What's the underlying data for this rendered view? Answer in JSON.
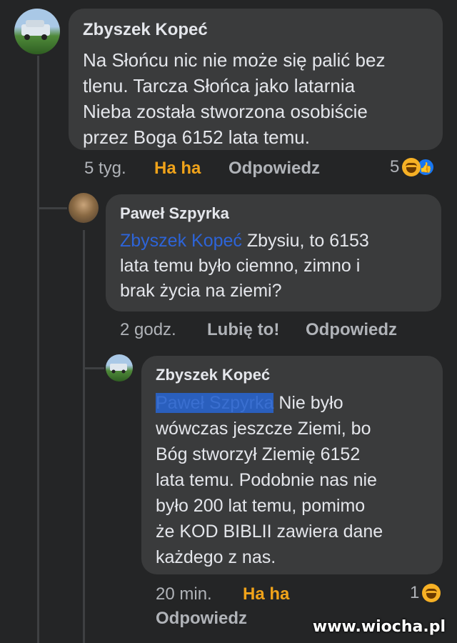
{
  "comments": [
    {
      "author": "Zbyszek Kopeć",
      "text_lines": [
        "Na Słońcu nic nie może się palić bez",
        "tlenu. Tarcza Słońca jako latarnia",
        "Nieba została stworzona osobiście",
        "przez Boga 6152 lata temu."
      ],
      "time": "5 tyg.",
      "reaction_label": "Ha ha",
      "reply_label": "Odpowiedz",
      "reaction_count": "5"
    },
    {
      "author": "Paweł Szpyrka",
      "mention": "Zbyszek Kopeć",
      "text_first": "Zbysiu, to 6153",
      "text_lines": [
        "lata temu było ciemno, zimno i",
        "brak życia na ziemi?"
      ],
      "time": "2 godz.",
      "like_label": "Lubię to!",
      "reply_label": "Odpowiedz"
    },
    {
      "author": "Zbyszek Kopeć",
      "mention": "Paweł Szpyrka",
      "text_first": "Nie było",
      "text_lines": [
        "wówczas jeszcze Ziemi, bo",
        "Bóg stworzył Ziemię 6152",
        "lata temu. Podobnie nas nie",
        "było 200 lat temu, pomimo",
        "że KOD BIBLII zawiera dane",
        "każdego z nas."
      ],
      "time": "20 min.",
      "reaction_label": "Ha ha",
      "reply_label": "Odpowiedz",
      "reaction_count": "1"
    }
  ],
  "watermark": "www.wiocha.pl",
  "colors": {
    "background": "#242526",
    "bubble": "#3a3b3c",
    "haha": "#f0a31a",
    "mention": "#2d64d8"
  }
}
